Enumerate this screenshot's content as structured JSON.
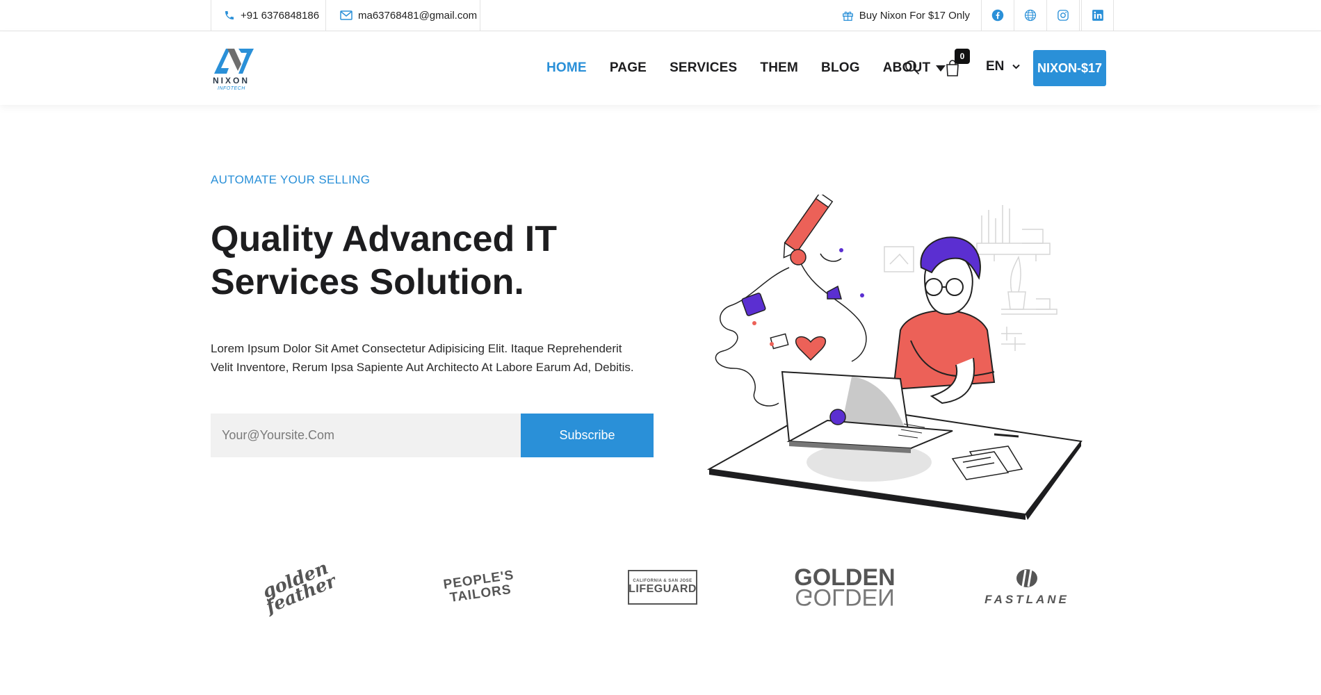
{
  "topbar": {
    "phone": "+91 6376848186",
    "email": "ma63768481@gmail.com",
    "promo": "Buy Nixon For $17 Only",
    "social": [
      {
        "icon": "facebook-icon"
      },
      {
        "icon": "globe-icon"
      },
      {
        "icon": "instagram-icon"
      },
      {
        "icon": "linkedin-icon"
      }
    ]
  },
  "header": {
    "logo_text": "NIXON",
    "logo_sub": "INFOTECH",
    "nav": [
      "HOME",
      "PAGE",
      "SERVICES",
      "THEM",
      "BLOG",
      "ABOUT"
    ],
    "active_nav": "HOME",
    "cart_count": "0",
    "language": "EN",
    "cta_label": "NIXON-$17"
  },
  "hero": {
    "kicker": "AUTOMATE YOUR SELLING",
    "headline_line1": "Quality Advanced IT",
    "headline_line2": "Services Solution.",
    "description": "Lorem Ipsum Dolor Sit Amet Consectetur Adipisicing Elit. Itaque Reprehenderit Velit Inventore, Rerum Ipsa Sapiente Aut Architecto At Labore Earum Ad, Debitis.",
    "email_placeholder": "Your@Yoursite.Com",
    "subscribe_label": "Subscribe"
  },
  "brands": {
    "golden_feather": "golden feather",
    "peoples_tailors_1": "PEOPLE'S",
    "peoples_tailors_2": "TAILORS",
    "lifeguard_small": "CALIFORNIA & SAN JOSE",
    "lifeguard_big": "LIFEGUARD",
    "golden": "GOLDEN",
    "fastlane": "FASTLANE"
  },
  "colors": {
    "accent": "#2a90d8",
    "underline": "#ef8a80",
    "shirt": "#ec6158",
    "hair": "#5b2fd1"
  }
}
